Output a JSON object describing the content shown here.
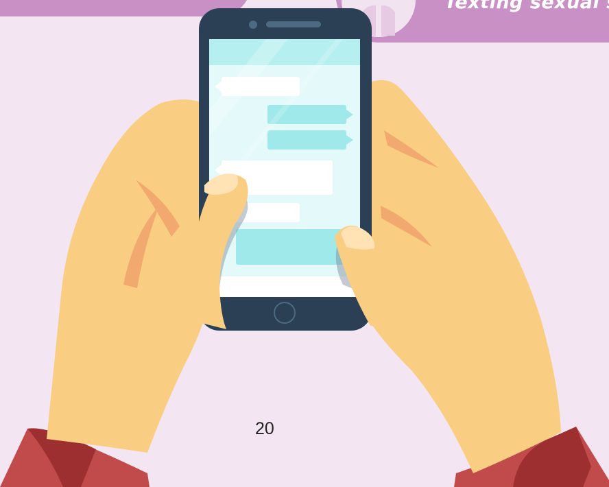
{
  "banner": {
    "text": "Texting sexual su"
  },
  "page": {
    "number": "20"
  },
  "colors": {
    "background": "#f3e6f2",
    "banner": "#c990c5",
    "skin": "#f9ce82",
    "skin_shadow": "#f1a96f",
    "sleeve": "#c14a4a",
    "sleeve_shadow": "#9e2f31",
    "phone_body": "#2c4055",
    "screen": "#e4f9f9",
    "bubble_in": "#ffffff",
    "bubble_out": "#9fe9ea"
  },
  "icons": {
    "banner_avatar": "person-silhouette-icon",
    "phone_home": "home-button-icon"
  }
}
